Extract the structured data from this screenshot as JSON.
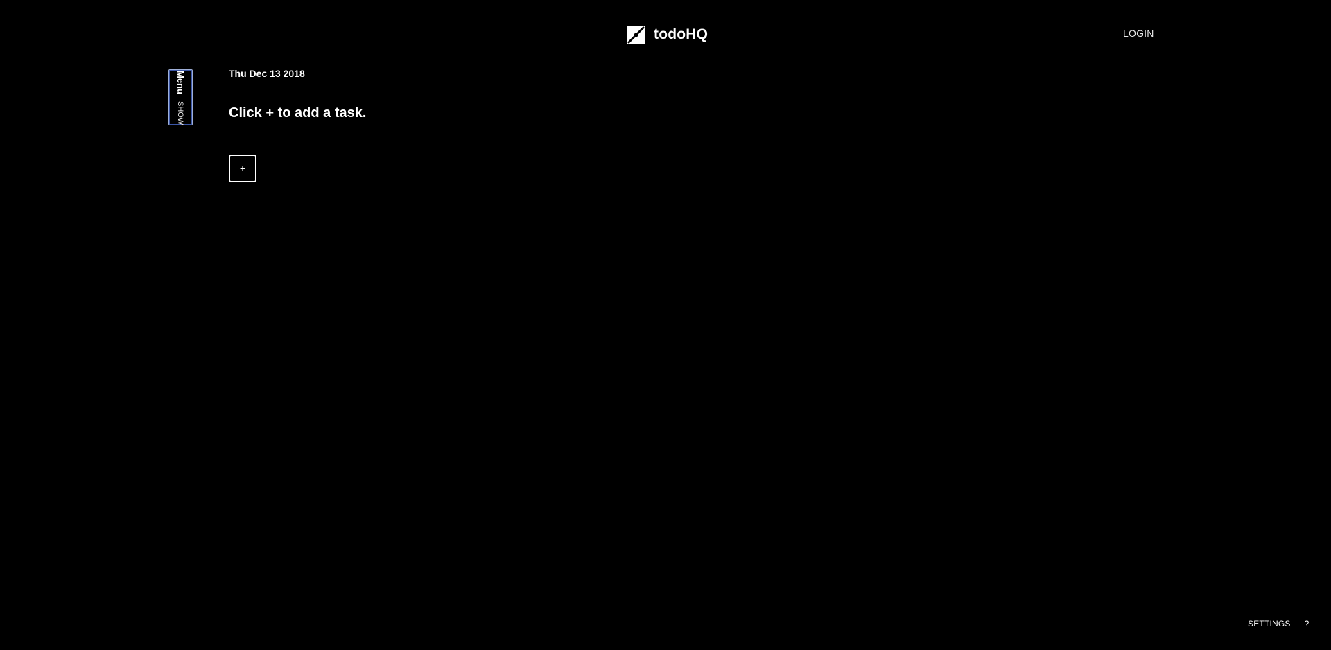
{
  "header": {
    "brand_name": "todoHQ",
    "logo_icon": "todohq-logo-icon",
    "login_label": "LOGIN"
  },
  "menu_toggle": {
    "title": "Menu",
    "state": "SHOW",
    "border_color": "#3c57a8"
  },
  "main": {
    "date": "Thu Dec 13 2018",
    "empty_hint": "Click + to add a task.",
    "add_button_label": "+"
  },
  "footer": {
    "settings_label": "SETTINGS",
    "help_label": "?"
  },
  "colors": {
    "background": "#000000",
    "text": "#ffffff",
    "menu_border": "#3c57a8"
  }
}
